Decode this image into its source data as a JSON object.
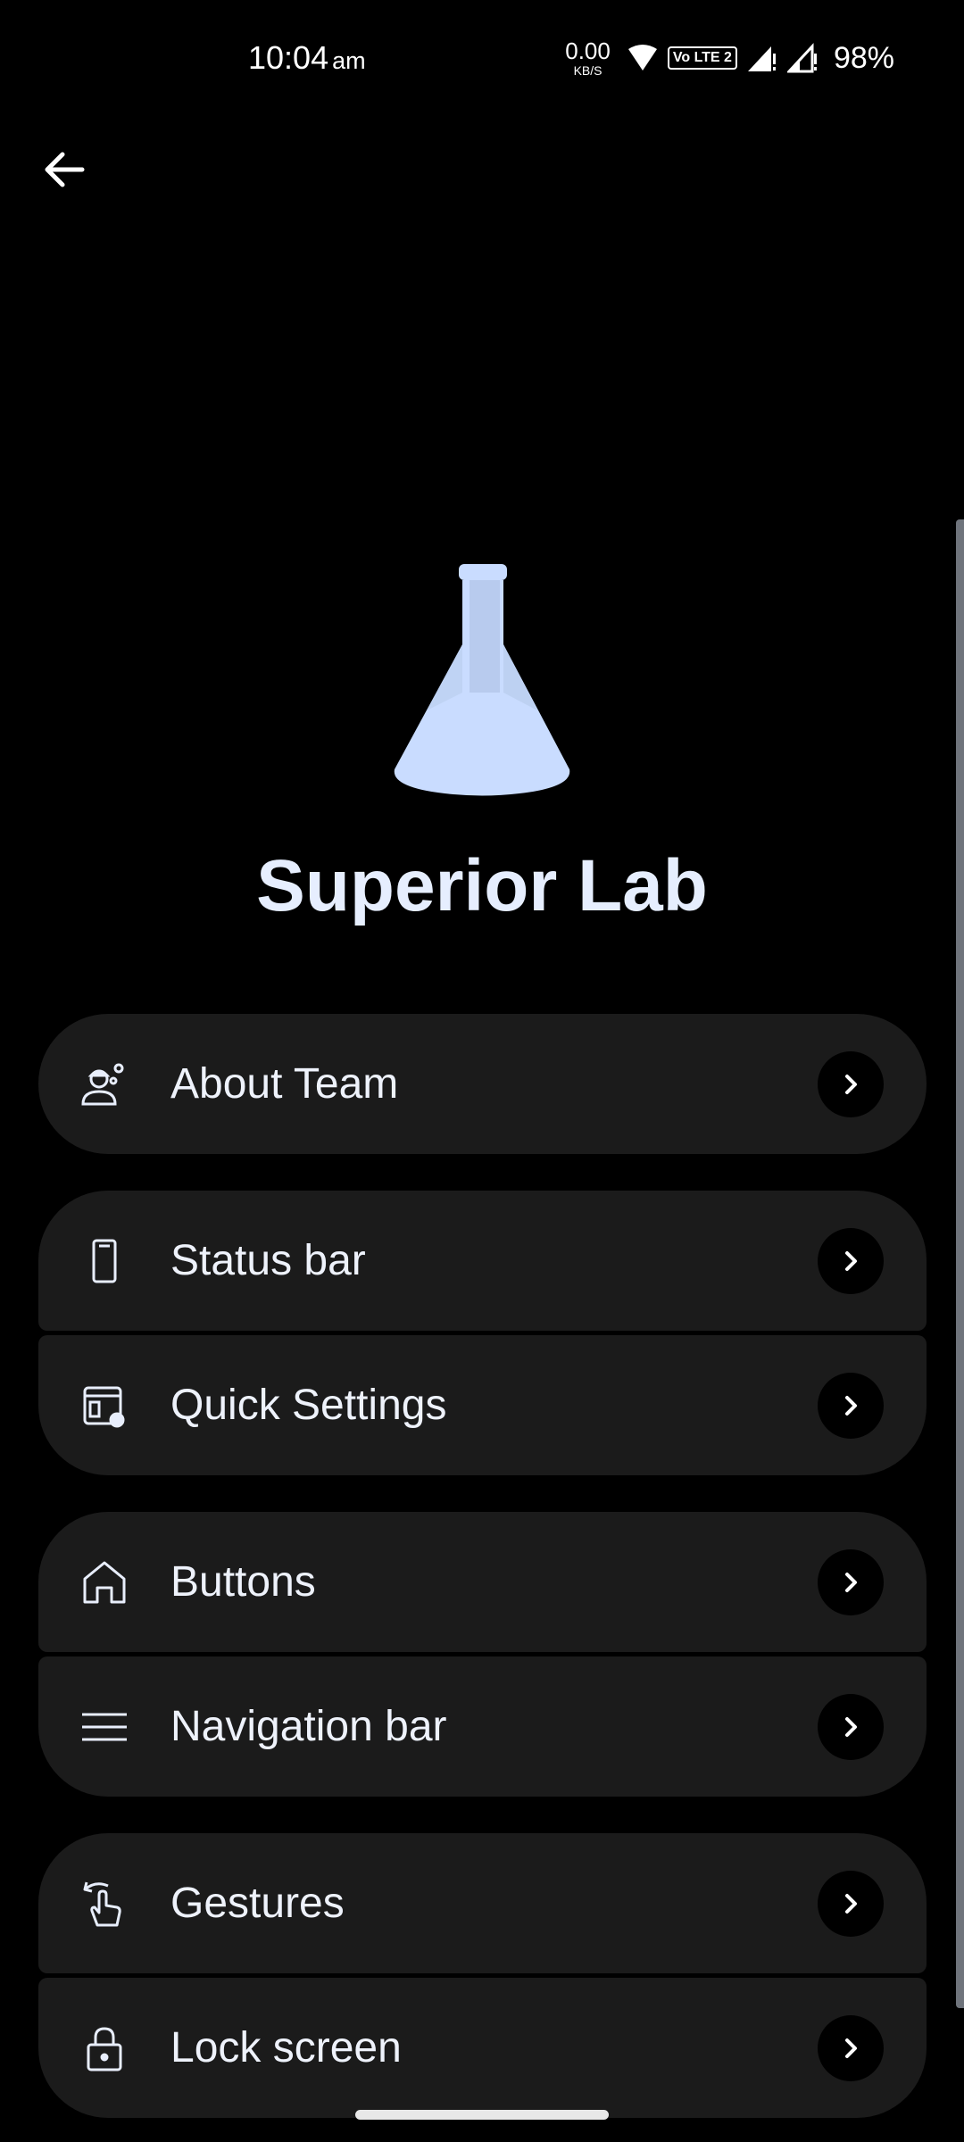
{
  "status_bar": {
    "time": "10:04",
    "ampm": "am",
    "net_speed_value": "0.00",
    "net_speed_unit": "KB/S",
    "volte": "Vo LTE 2",
    "battery": "98%"
  },
  "header": {
    "title": "Superior Lab"
  },
  "menu": [
    {
      "label": "About Team",
      "icon": "team-gear-icon"
    },
    {
      "label": "Status bar",
      "icon": "phone-icon"
    },
    {
      "label": "Quick Settings",
      "icon": "quick-settings-icon"
    },
    {
      "label": "Buttons",
      "icon": "home-icon"
    },
    {
      "label": "Navigation bar",
      "icon": "menu-lines-icon"
    },
    {
      "label": "Gestures",
      "icon": "gesture-icon"
    },
    {
      "label": "Lock screen",
      "icon": "lock-icon"
    }
  ],
  "colors": {
    "background": "#000000",
    "card": "#1b1b1b",
    "accent": "#c9dcff"
  }
}
